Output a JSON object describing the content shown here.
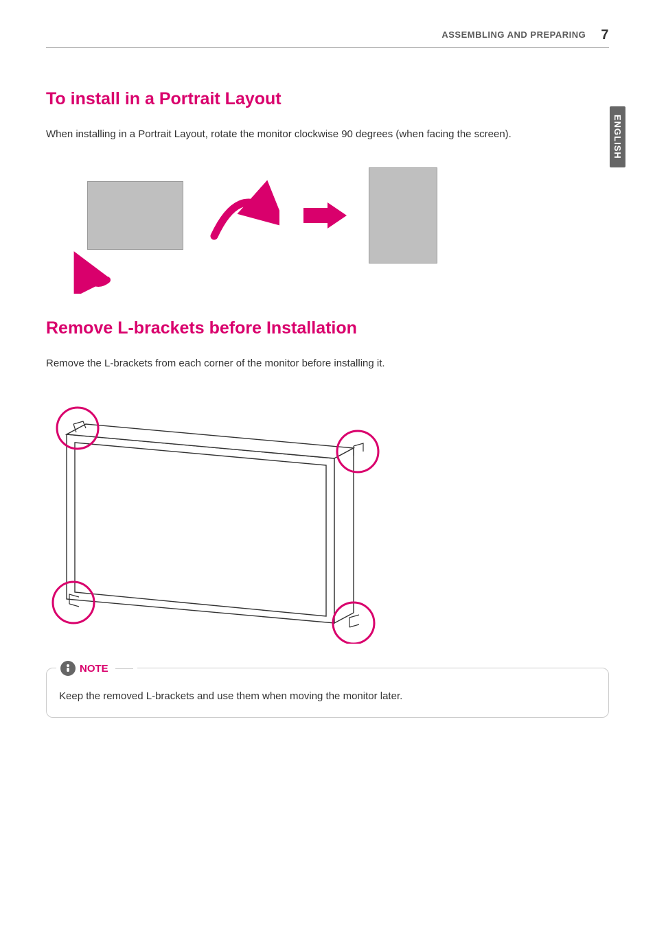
{
  "header": {
    "section_label": "ASSEMBLING AND PREPARING",
    "page_number": "7"
  },
  "language_tab": "ENGLISH",
  "section1": {
    "title": "To install in a Portrait Layout",
    "body": "When installing in a Portrait Layout, rotate the monitor clockwise 90 degrees (when facing the screen)."
  },
  "section2": {
    "title": "Remove L-brackets before Installation",
    "body": "Remove the L-brackets from each corner of the monitor before installing it."
  },
  "note": {
    "label": "NOTE",
    "body": "Keep the removed L-brackets and use them when moving the monitor later."
  },
  "colors": {
    "accent": "#d9006c",
    "gray_fill": "#bfbfbf"
  }
}
